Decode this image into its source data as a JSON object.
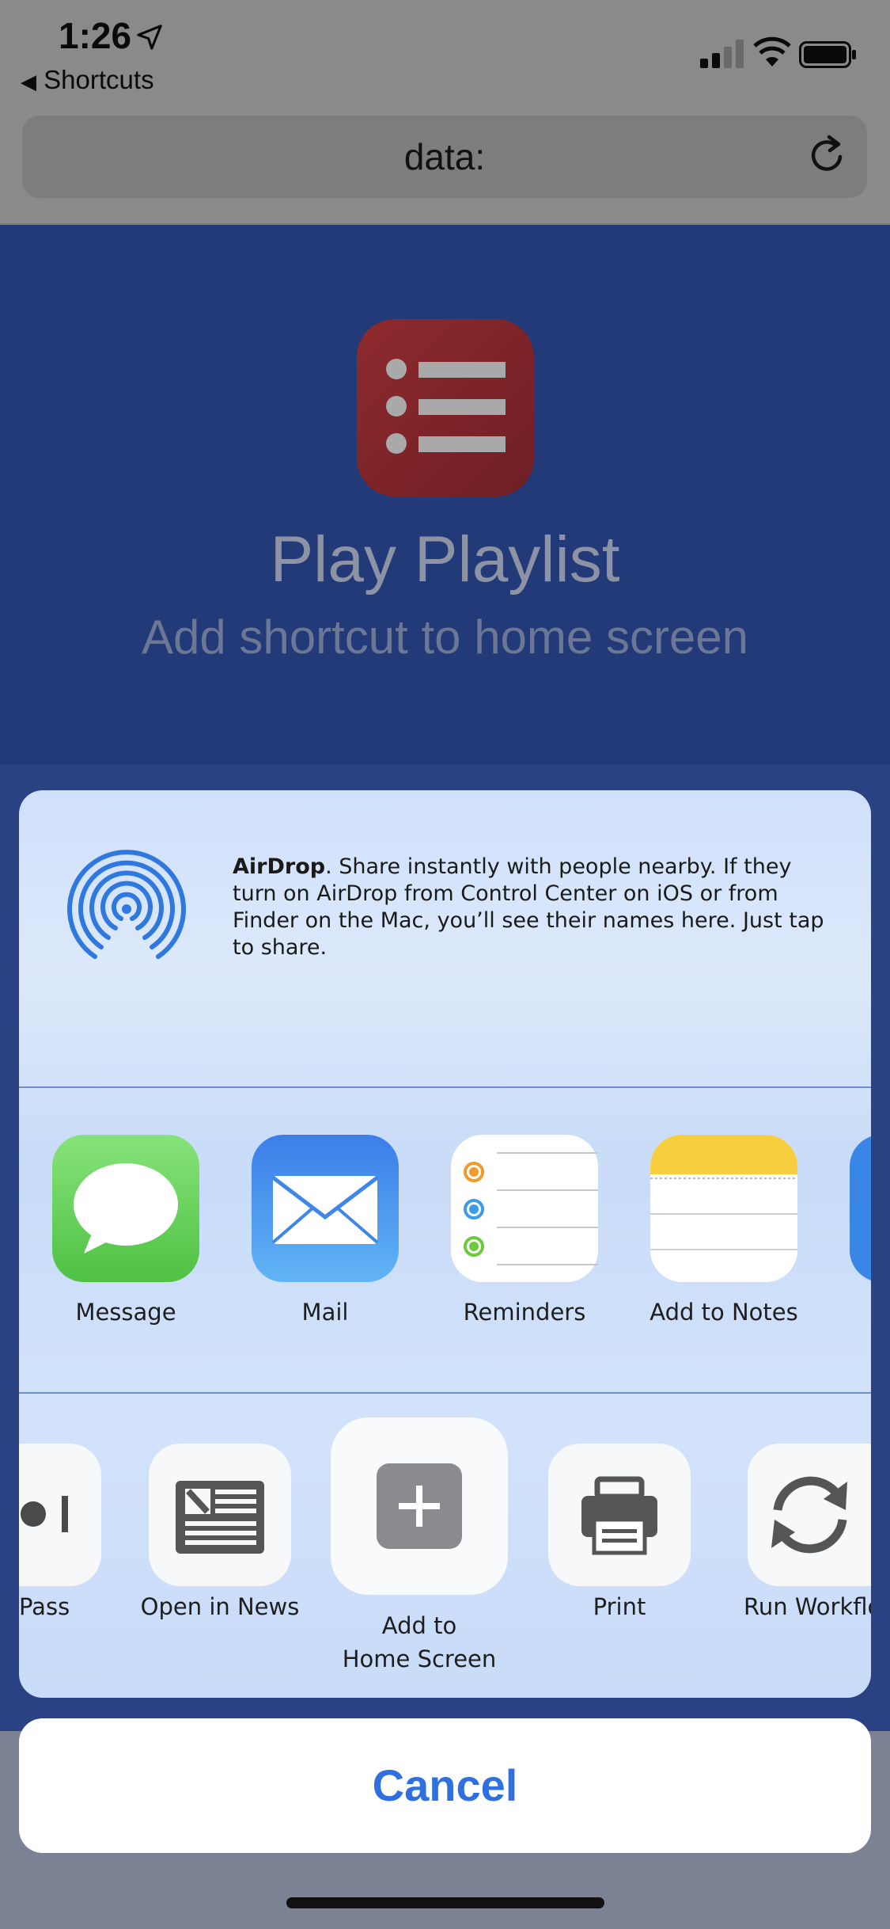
{
  "status_bar": {
    "time": "1:26",
    "back_label": "Shortcuts"
  },
  "url_bar": {
    "url": "data:"
  },
  "page": {
    "title": "Play Playlist",
    "subtitle": "Add shortcut to home screen"
  },
  "share_sheet": {
    "airdrop": {
      "title": "AirDrop",
      "description": ". Share instantly with people nearby. If they turn on AirDrop from Control Center on iOS or from Finder on the Mac, you’ll see their names here. Just tap to share."
    },
    "apps": [
      {
        "label": "Message",
        "icon": "message-icon"
      },
      {
        "label": "Mail",
        "icon": "mail-icon"
      },
      {
        "label": "Reminders",
        "icon": "reminders-icon"
      },
      {
        "label": "Add to Notes",
        "icon": "notes-icon"
      }
    ],
    "actions": [
      {
        "label": "Pass",
        "icon": "wallet-pass-icon"
      },
      {
        "label": "Open in News",
        "icon": "news-icon"
      },
      {
        "label_line1": "Add to",
        "label_line2": "Home Screen",
        "icon": "add-icon"
      },
      {
        "label": "Print",
        "icon": "printer-icon"
      },
      {
        "label": "Run Workflo",
        "icon": "refresh-icon"
      }
    ]
  },
  "cancel_label": "Cancel",
  "colors": {
    "accent": "#2f6fde",
    "page_bg": "#233a78",
    "app_icon": "#8e2a2e"
  }
}
